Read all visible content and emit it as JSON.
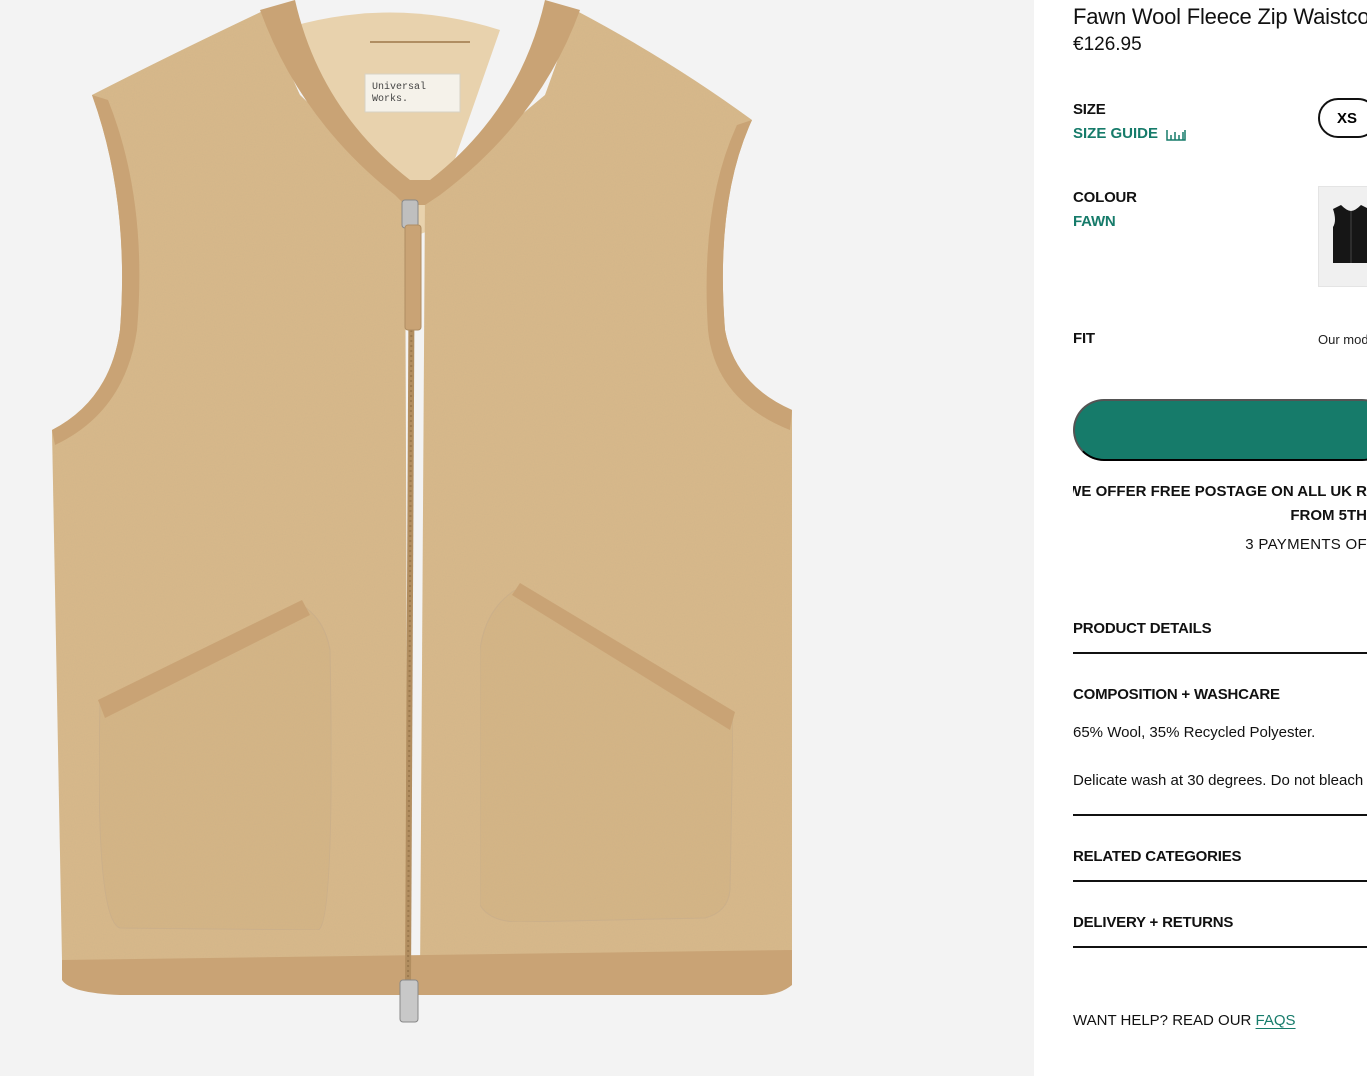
{
  "product": {
    "image": {
      "alt": "Fawn Wool Fleece Zip Waistcoat",
      "brand_label": "Universal Works."
    },
    "title": "Fawn Wool Fleece Zip Waistcoat",
    "price": "€126.95"
  },
  "size": {
    "label": "SIZE",
    "guide_label": "SIZE GUIDE",
    "guide_icon": "ruler-icon",
    "options": [
      "XS"
    ]
  },
  "colour": {
    "label": "COLOUR",
    "value": "FAWN",
    "swatch_icon": "black-waistcoat-thumbnail"
  },
  "fit": {
    "label": "FIT",
    "note": "Our model is"
  },
  "cart": {
    "button_color": "#167b6a"
  },
  "postage": {
    "line1": "WE OFFER FREE POSTAGE ON ALL UK R",
    "line2": "FROM 5TH",
    "payments": "3 PAYMENTS OF"
  },
  "accordion": {
    "product_details": "PRODUCT DETAILS",
    "composition": "COMPOSITION + WASHCARE",
    "composition_text": "65% Wool, 35% Recycled Polyester.",
    "washcare_text": "Delicate wash at 30 degrees. Do not bleach",
    "related": "RELATED CATEGORIES",
    "delivery": "DELIVERY + RETURNS"
  },
  "help": {
    "text": "WANT HELP? READ OUR ",
    "link": "FAQS"
  },
  "colors": {
    "accent": "#167b6a",
    "fleece": "#d9b98a",
    "rib": "#c9a375"
  }
}
